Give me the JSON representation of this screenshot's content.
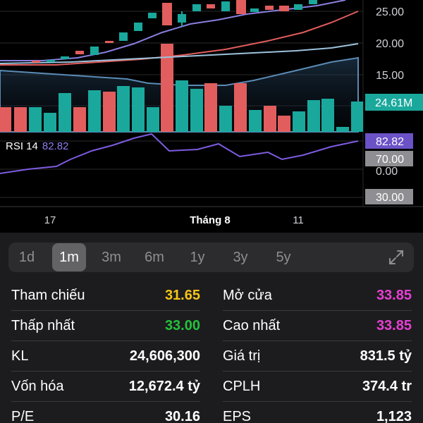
{
  "chart": {
    "price_axis": [
      "25.00",
      "20.00",
      "15.00"
    ],
    "volume_badge": "24.61M",
    "rsi_label": "RSI 14",
    "rsi_value": "82.82",
    "rsi_axis": [
      "82.82",
      "70.00",
      "0.00",
      "30.00"
    ],
    "x_ticks": [
      "17",
      "Tháng 8",
      "11"
    ],
    "colors": {
      "up": "#1aa89c",
      "down": "#e25d5d",
      "volume_badge": "#1aa89c",
      "rsi_line": "#7c5ce0",
      "rsi_badge": "#6b52c7"
    }
  },
  "timeframes": {
    "items": [
      "1d",
      "1m",
      "3m",
      "6m",
      "1y",
      "3y",
      "5y"
    ],
    "active": "1m"
  },
  "stats": {
    "rows": [
      {
        "l_label": "Tham chiếu",
        "l_value": "31.65",
        "l_color": "#f5c518",
        "r_label": "Mở cửa",
        "r_value": "33.85",
        "r_color": "#e83fd4"
      },
      {
        "l_label": "Thấp nhất",
        "l_value": "33.00",
        "l_color": "#25c23c",
        "r_label": "Cao nhất",
        "r_value": "33.85",
        "r_color": "#e83fd4"
      },
      {
        "l_label": "KL",
        "l_value": "24,606,300",
        "l_color": "#ffffff",
        "r_label": "Giá trị",
        "r_value": "831.5 tỷ",
        "r_color": "#ffffff"
      },
      {
        "l_label": "Vốn hóa",
        "l_value": "12,672.4 tỷ",
        "l_color": "#ffffff",
        "r_label": "CPLH",
        "r_value": "374.4 tr",
        "r_color": "#ffffff"
      },
      {
        "l_label": "P/E",
        "l_value": "30.16",
        "l_color": "#ffffff",
        "r_label": "EPS",
        "r_value": "1,123",
        "r_color": "#ffffff"
      }
    ]
  }
}
